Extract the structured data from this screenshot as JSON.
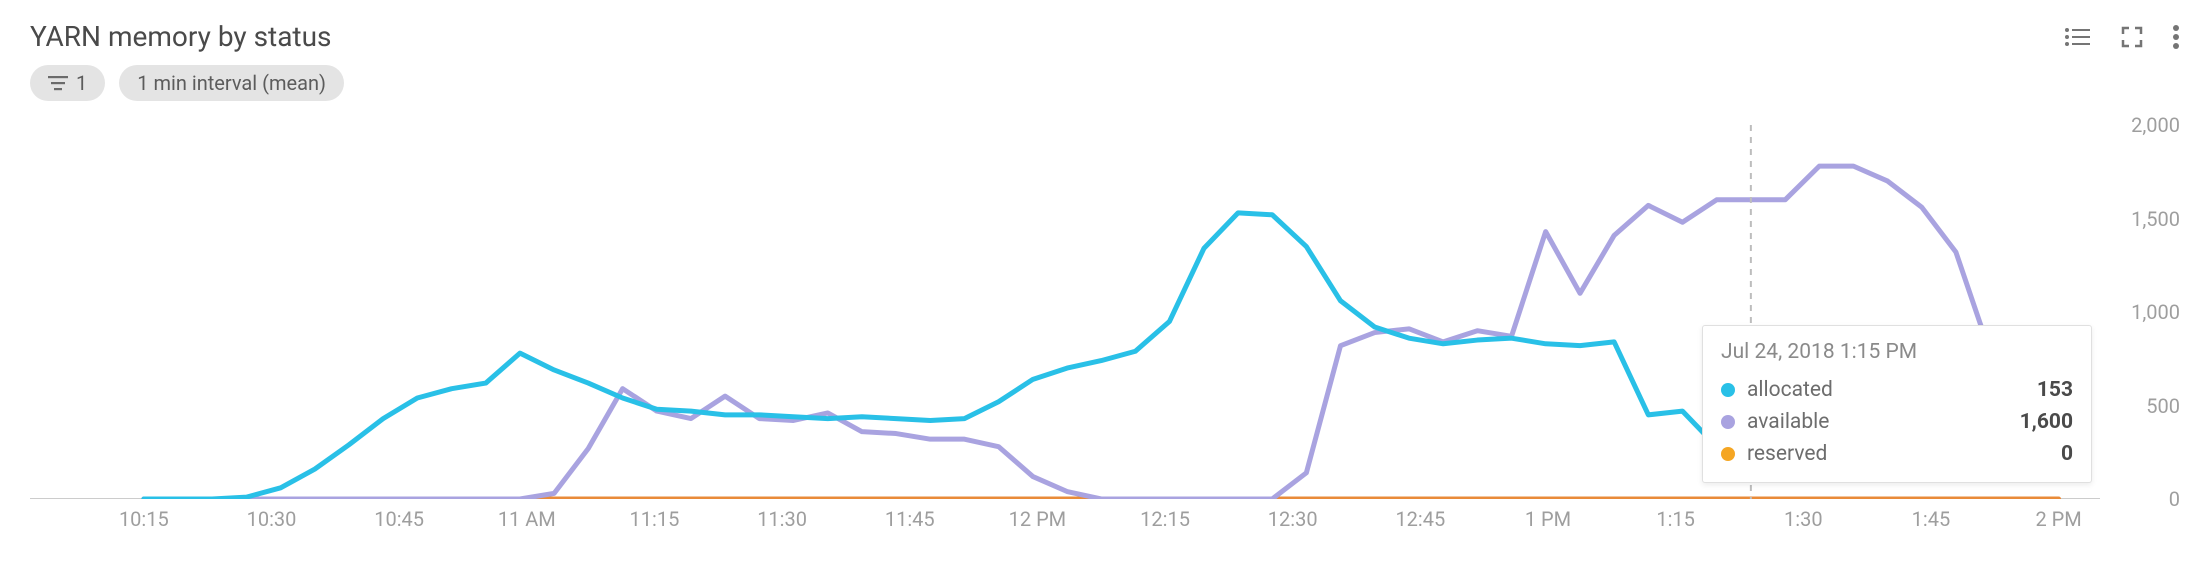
{
  "header": {
    "title": "YARN memory by status"
  },
  "chips": {
    "filter_count": "1",
    "interval_label": "1 min interval (mean)"
  },
  "axes": {
    "y_ticks": [
      "0",
      "500",
      "1,000",
      "1,500",
      "2,000"
    ],
    "x_ticks": [
      "10:15",
      "10:30",
      "10:45",
      "11 AM",
      "11:15",
      "11:30",
      "11:45",
      "12 PM",
      "12:15",
      "12:30",
      "12:45",
      "1 PM",
      "1:15",
      "1:30",
      "1:45",
      "2 PM"
    ]
  },
  "tooltip": {
    "time": "Jul 24, 2018 1:15 PM",
    "rows": [
      {
        "label": "allocated",
        "value": "153",
        "color": "#29c0e7"
      },
      {
        "label": "available",
        "value": "1,600",
        "color": "#a9a3e0"
      },
      {
        "label": "reserved",
        "value": "0",
        "color": "#f5a623"
      }
    ]
  },
  "colors": {
    "allocated": "#29c0e7",
    "available": "#a9a3e0",
    "reserved": "#e98b39"
  },
  "chart_data": {
    "type": "line",
    "title": "YARN memory by status",
    "xlabel": "",
    "ylabel": "",
    "ylim": [
      0,
      2000
    ],
    "x_time_range": [
      "2018-07-24T10:15",
      "2018-07-24T14:00"
    ],
    "x": [
      "10:15",
      "10:20",
      "10:25",
      "10:30",
      "10:35",
      "10:40",
      "10:45",
      "10:50",
      "10:55",
      "11:00",
      "11:05",
      "11:08",
      "11:10",
      "11:12",
      "11:15",
      "11:18",
      "11:20",
      "11:22",
      "11:25",
      "11:28",
      "11:30",
      "11:35",
      "11:40",
      "11:45",
      "11:50",
      "11:55",
      "12:00",
      "12:05",
      "12:10",
      "12:15",
      "12:20",
      "12:23",
      "12:25",
      "12:27",
      "12:30",
      "12:33",
      "12:35",
      "12:38",
      "12:40",
      "12:43",
      "12:45",
      "12:48",
      "12:50",
      "12:55",
      "13:00",
      "13:05",
      "13:10",
      "13:15",
      "13:20",
      "13:25",
      "13:30",
      "13:35",
      "13:40",
      "13:45",
      "13:50",
      "13:55",
      "14:00"
    ],
    "series": [
      {
        "name": "allocated",
        "color": "#29c0e7",
        "values": [
          0,
          0,
          0,
          10,
          60,
          160,
          290,
          430,
          540,
          590,
          620,
          780,
          690,
          620,
          540,
          480,
          470,
          450,
          450,
          440,
          430,
          440,
          430,
          420,
          430,
          520,
          640,
          700,
          740,
          790,
          950,
          1340,
          1530,
          1520,
          1350,
          1060,
          920,
          860,
          830,
          850,
          860,
          830,
          820,
          840,
          450,
          470,
          280,
          153,
          145,
          145,
          145,
          145,
          145,
          145,
          145,
          145,
          145
        ]
      },
      {
        "name": "available",
        "color": "#a9a3e0",
        "values": [
          0,
          0,
          0,
          0,
          0,
          0,
          0,
          0,
          0,
          0,
          0,
          0,
          30,
          270,
          590,
          470,
          430,
          550,
          430,
          420,
          460,
          360,
          350,
          320,
          320,
          280,
          120,
          40,
          0,
          0,
          0,
          0,
          0,
          0,
          140,
          820,
          890,
          910,
          840,
          900,
          870,
          1430,
          1100,
          1410,
          1570,
          1480,
          1600,
          1600,
          1600,
          1780,
          1780,
          1700,
          1560,
          1320,
          780,
          320,
          200
        ]
      },
      {
        "name": "reserved",
        "color": "#e98b39",
        "values": [
          0,
          0,
          0,
          0,
          0,
          0,
          0,
          0,
          0,
          0,
          0,
          0,
          0,
          0,
          0,
          0,
          0,
          0,
          0,
          0,
          0,
          0,
          0,
          0,
          0,
          0,
          0,
          0,
          0,
          0,
          0,
          0,
          0,
          0,
          0,
          0,
          0,
          0,
          0,
          0,
          0,
          0,
          0,
          0,
          0,
          0,
          0,
          0,
          0,
          0,
          0,
          0,
          0,
          0,
          0,
          0,
          0
        ]
      }
    ],
    "hover_index": 47,
    "hover_time": "Jul 24, 2018 1:15 PM"
  }
}
